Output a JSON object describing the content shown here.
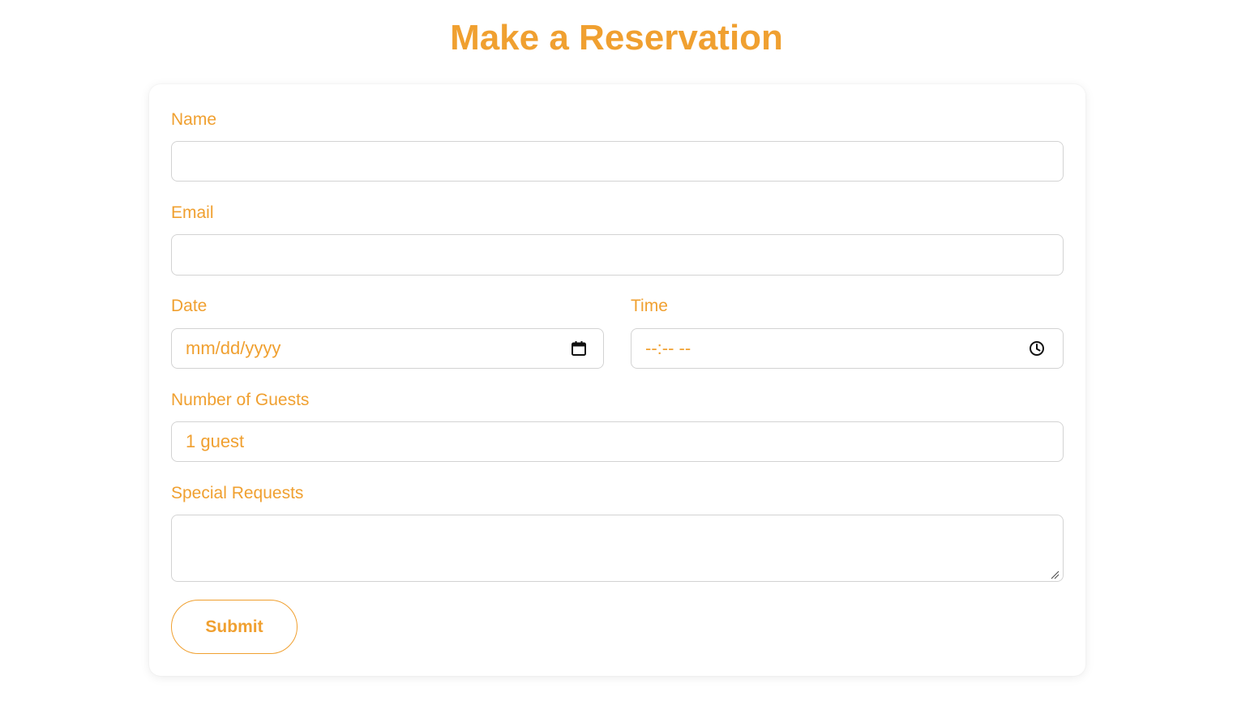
{
  "colors": {
    "accent": "#f0a030",
    "input_border": "#d3d3d3",
    "icon": "#111111"
  },
  "page_title": "Make a Reservation",
  "form": {
    "name": {
      "label": "Name",
      "value": ""
    },
    "email": {
      "label": "Email",
      "value": ""
    },
    "date": {
      "label": "Date",
      "placeholder": "mm/dd/yyyy",
      "icon": "calendar-icon"
    },
    "time": {
      "label": "Time",
      "placeholder": "--:-- --",
      "icon": "clock-icon"
    },
    "guests": {
      "label": "Number of Guests",
      "selected": "1 guest"
    },
    "special_requests": {
      "label": "Special Requests",
      "value": ""
    },
    "submit_label": "Submit"
  }
}
